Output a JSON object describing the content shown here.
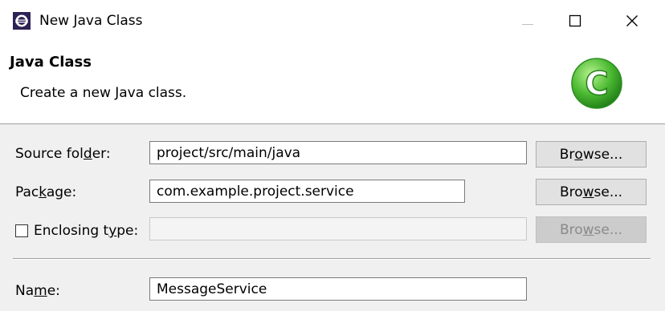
{
  "window": {
    "title": "New Java Class",
    "title_icon": "eclipse-icon",
    "controls": {
      "minimize": "minimize-icon",
      "maximize": "maximize-icon",
      "close": "close-icon"
    }
  },
  "banner": {
    "title": "Java Class",
    "description": "Create a new Java class.",
    "icon": "java-class-c-icon"
  },
  "form": {
    "source_folder": {
      "label_pre": "Source fol",
      "label_key": "d",
      "label_post": "er:",
      "value": "project/src/main/java",
      "button_pre": "Br",
      "button_key": "o",
      "button_post": "wse..."
    },
    "package": {
      "label_pre": "Pac",
      "label_key": "k",
      "label_post": "age:",
      "value": "com.example.project.service",
      "button_pre": "Bro",
      "button_key": "w",
      "button_post": "se..."
    },
    "enclosing_type": {
      "label_pre": "Enclosing t",
      "label_key": "y",
      "label_post": "pe:",
      "checked": false,
      "value": "",
      "button_pre": "Bro",
      "button_key": "w",
      "button_post": "se...",
      "button_enabled": false
    },
    "name": {
      "label_pre": "Na",
      "label_key": "m",
      "label_post": "e:",
      "value": "MessageService"
    }
  },
  "colors": {
    "banner_background": "#ffffff",
    "content_background": "#f0f0f0",
    "button_background": "#e1e1e1",
    "icon_green": "#3fae2a"
  }
}
